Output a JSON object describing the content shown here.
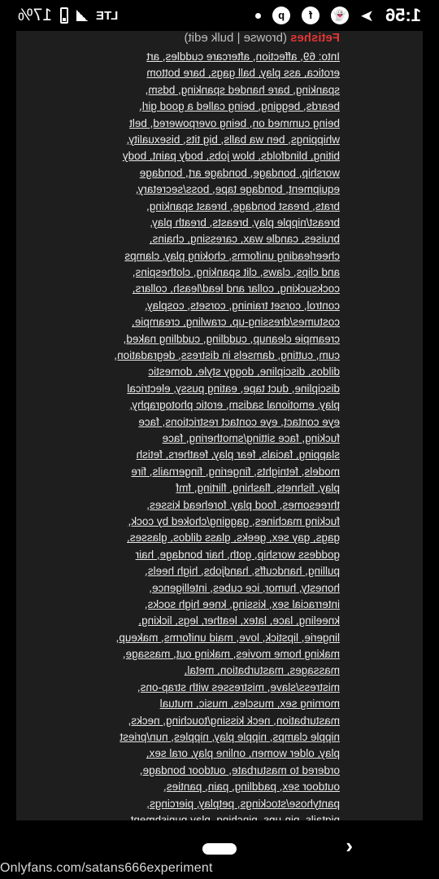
{
  "status_bar": {
    "time": "1:56",
    "network": "LTE",
    "battery": "17%"
  },
  "icons": [
    "send-icon",
    "snapchat-icon",
    "facebook-icon",
    "pinterest-icon",
    "dot-icon",
    "signal-icon",
    "battery-icon"
  ],
  "heading": {
    "category": "Fetishes",
    "links": "(browse | bulk edit)"
  },
  "info_label": "Into:",
  "lines": [
    "Into: 69, affection, aftercare cuddles, art",
    "erotica, ass play, ball gags, bare bottom",
    "spanking, bare handed spanking, bdsm,",
    "beards, begging, being called a good girl,",
    "being cummed on, being overpowered, belt",
    "whippings, ben wa balls, big tits, bisexuality,",
    "biting, blindfolds, blow jobs, body paint, body",
    "worship, bondage, bondage art, bondage",
    "equipment, bondage tape, boss/secretary,",
    "brats, breast bondage, breast spanking,",
    "breast/nipple play, breasts, breath play,",
    "bruises, candle wax, caressing, chains,",
    "cheerleading uniforms, choking play, clamps",
    "and clips, claws, clit spanking, clothespins,",
    "cocksucking, collar and lead/leash, collars,",
    "control, corset training, corsets, cosplay,",
    "costumes/dressing-up, crawling, creampie,",
    "creampie cleanup, cuddling, cuddling naked,",
    "cum, cutting, damsels in distress, degradation,",
    "dildos, discipline, doggy style, domestic",
    "discipline, duct tape, eating pussy, electrical",
    "play, emotional sadism, erotic photography,",
    "eye contact, eye contact restrictions, face",
    "fucking, face sitting/smothering, face",
    "slapping, facials, fear play, feathers, fetish",
    "models, fetnights, fingering, fingernails, fire",
    "play, fishnets, flashing, flirting, fmf",
    "threesomes, food play, forehead kisses,",
    "fucking machines, gagging/choked by cock,",
    "gags, gay sex, geeks, glass dildos, glasses,",
    "goddess worship, goth, hair bondage, hair",
    "pulling, handcuffs, handjobs, high heels,",
    "honesty, humor, ice cubes, intelligence,",
    "interracial sex, kissing, knee high socks,",
    "kneeling, lace, latex, leather, legs, licking,",
    "lingerie, lipstick, love, maid uniforms, makeup,",
    "making home movies, making out, massage,",
    "massages, masturbation, metal,",
    "mistress/slave, mistresses with strap-ons,",
    "morning sex, muscles, music, mutual",
    "masturbation, neck kissing/touching, necks,",
    "nipple clamps, nipple play, nipples, nun/priest",
    "play, older women, online play, oral sex,",
    "ordered to masturbate, outdoor bondage,",
    "outdoor sex, paddling, pain, panties,",
    "pantyhose/stockings, petplay, piercings,",
    "pigtails, pin-ups, pinching, play punishment,"
  ],
  "watermark": "Onlyfans.com/satans666experiment"
}
